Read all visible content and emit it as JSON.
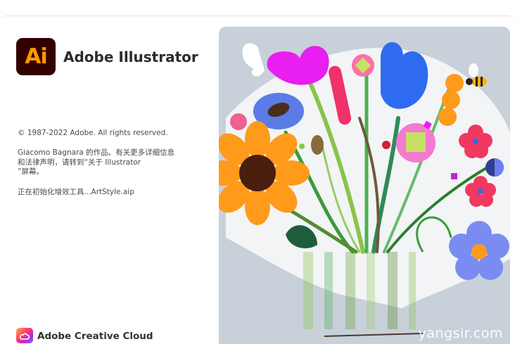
{
  "app": {
    "logo_text": "Ai",
    "name": "Adobe Illustrator"
  },
  "info": {
    "copyright": "© 1987-2022 Adobe. All rights reserved.",
    "credit_line1": "Giacomo Bagnara 的作品。有关更多详细信息",
    "credit_line2": "和法律声明，请转到“关于 Illustrator",
    "credit_line3": "”屏幕。",
    "status": "正在初始化增效工具...ArtStyle.aip"
  },
  "footer": {
    "brand": "Adobe Creative Cloud"
  },
  "artwork": {
    "watermark": "yangsir.com"
  },
  "colors": {
    "ai_bg": "#330000",
    "ai_text": "#ff9a00",
    "art_bg": "#c8d0da"
  }
}
